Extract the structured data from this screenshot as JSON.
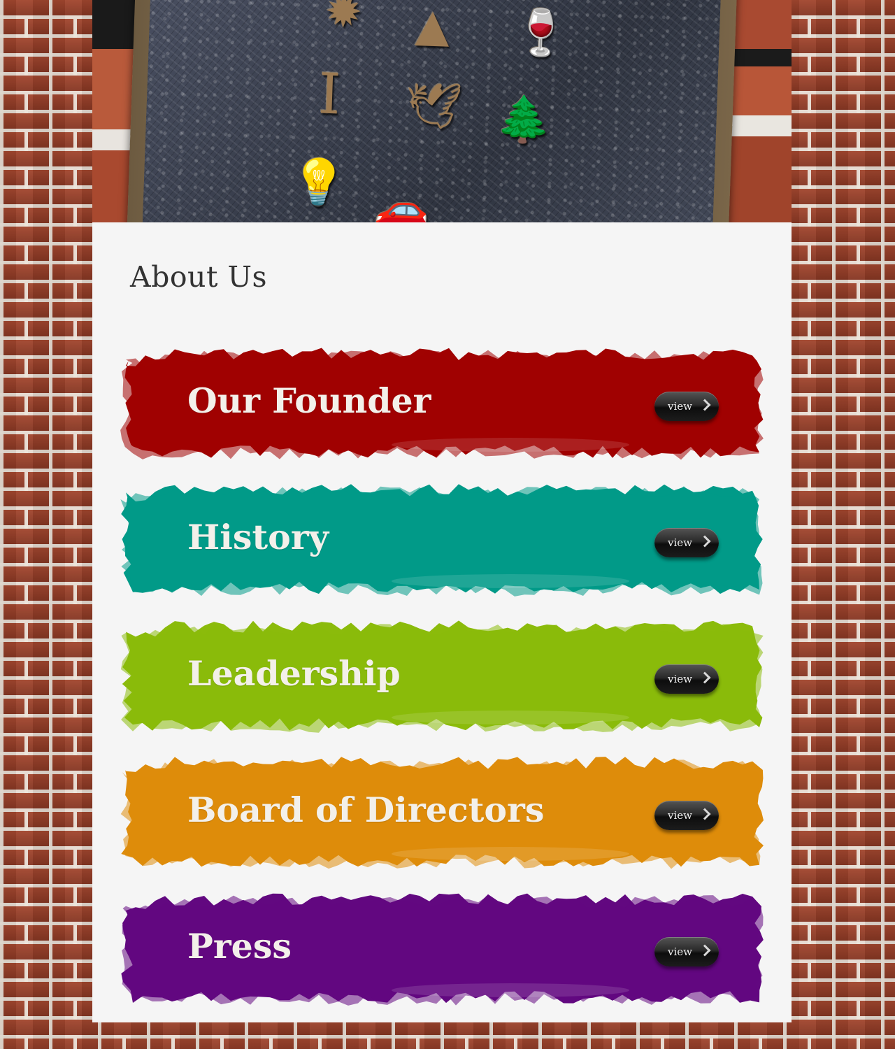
{
  "page": {
    "title": "About Us"
  },
  "colors": {
    "founder": "#a00201",
    "history": "#019a88",
    "leadership": "#8bbb0b",
    "board": "#de8c0b",
    "press": "#620880",
    "content_bg": "#f5f5f5"
  },
  "hero": {
    "image": "bronze plaque with emblems on brick wall"
  },
  "items": [
    {
      "label": "Our Founder",
      "button": "view",
      "color": "#a00201"
    },
    {
      "label": "History",
      "button": "view",
      "color": "#019a88"
    },
    {
      "label": "Leadership",
      "button": "view",
      "color": "#8bbb0b"
    },
    {
      "label": "Board of Directors",
      "button": "view",
      "color": "#de8c0b"
    },
    {
      "label": "Press",
      "button": "view",
      "color": "#620880"
    }
  ]
}
